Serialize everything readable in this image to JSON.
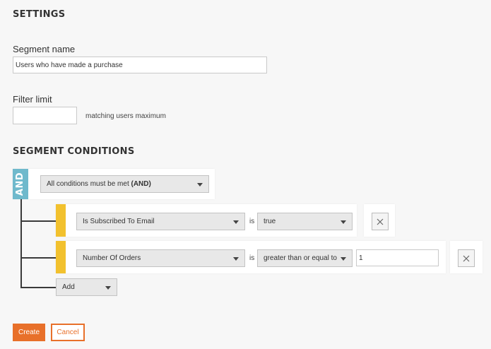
{
  "settings": {
    "title": "SETTINGS",
    "segment_name_label": "Segment name",
    "segment_name_value": "Users who have made a purchase",
    "filter_limit_label": "Filter limit",
    "filter_limit_value": "",
    "filter_limit_suffix": "matching users maximum"
  },
  "conditions": {
    "title": "SEGMENT CONDITIONS",
    "operator_badge": "AND",
    "mode_select_prefix": "All conditions must be met",
    "mode_select_strong": "(AND)",
    "rows": [
      {
        "field": "Is Subscribed To Email",
        "connector": "is",
        "operator": "true",
        "value": null
      },
      {
        "field": "Number Of Orders",
        "connector": "is",
        "operator": "greater than or equal to",
        "value": "1"
      }
    ],
    "add_label": "Add"
  },
  "actions": {
    "create_label": "Create",
    "cancel_label": "Cancel"
  },
  "colors": {
    "accent": "#e8702a",
    "badge": "#6fb9cc",
    "condition_bar": "#f2c12e"
  },
  "icons": {
    "remove": "close-icon",
    "dropdown": "chevron-down-icon"
  }
}
